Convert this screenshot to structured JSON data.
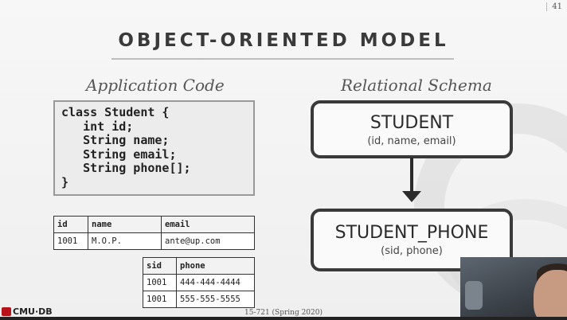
{
  "slide": {
    "page_number": "41",
    "title": "OBJECT-ORIENTED MODEL",
    "left_heading": "Application Code",
    "right_heading": "Relational Schema",
    "footer_course": "15-721 (Spring 2020)",
    "footer_logo": "CMU·DB"
  },
  "code": {
    "text": "class Student {\n   int id;\n   String name;\n   String email;\n   String phone[];\n}"
  },
  "student_table": {
    "headers": [
      "id",
      "name",
      "email"
    ],
    "rows": [
      [
        "1001",
        "M.O.P.",
        "ante@up.com"
      ]
    ]
  },
  "phone_table": {
    "headers": [
      "sid",
      "phone"
    ],
    "rows": [
      [
        "1001",
        "444-444-4444"
      ],
      [
        "1001",
        "555-555-5555"
      ]
    ]
  },
  "schema": {
    "entity1": {
      "name": "STUDENT",
      "attrs": "(id, name, email)"
    },
    "entity2": {
      "name": "STUDENT_PHONE",
      "attrs": "(sid, phone)"
    }
  },
  "colors": {
    "logo_red": "#b5121b",
    "box_border": "#3a3a3a"
  },
  "icons": {
    "logo": "cmu-db-logo-icon",
    "arrow": "down-arrow-icon"
  }
}
